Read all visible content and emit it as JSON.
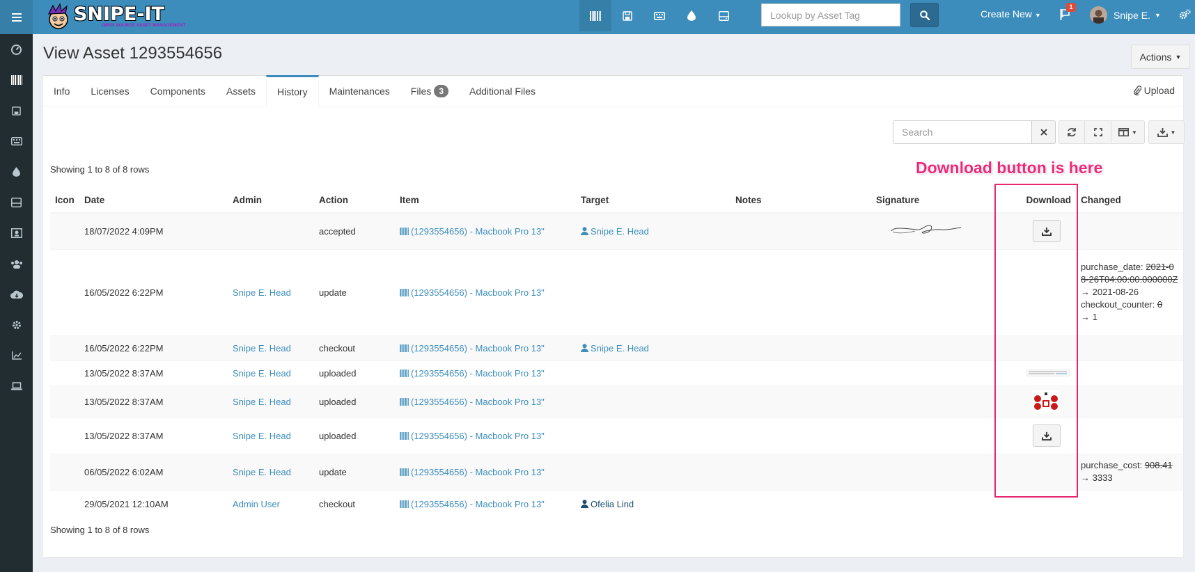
{
  "header": {
    "brand": "SNIPE-IT",
    "brand_tagline": "OPEN SOURCE ASSET MANAGEMENT",
    "lookup_placeholder": "Lookup by Asset Tag",
    "create_new": "Create New",
    "notifications_count": "1",
    "user_name": "Snipe E.",
    "nav_icons": [
      "barcode-icon",
      "save-icon",
      "keyboard-icon",
      "drop-icon",
      "hdd-icon"
    ]
  },
  "sidebar": {
    "items": [
      "dashboard-icon",
      "barcode-icon",
      "save-icon",
      "keyboard-icon",
      "drop-icon",
      "hdd-icon",
      "license-icon",
      "users-icon",
      "cloud-download-icon",
      "settings-icon",
      "chart-icon",
      "laptop-icon"
    ]
  },
  "page": {
    "title": "View Asset 1293554656",
    "actions_label": "Actions"
  },
  "tabs": [
    {
      "label": "Info"
    },
    {
      "label": "Licenses"
    },
    {
      "label": "Components"
    },
    {
      "label": "Assets"
    },
    {
      "label": "History",
      "active": true
    },
    {
      "label": "Maintenances"
    },
    {
      "label": "Files",
      "badge": "3"
    },
    {
      "label": "Additional Files"
    }
  ],
  "upload_label": "Upload",
  "table_search": {
    "placeholder": "Search"
  },
  "showing_text": "Showing 1 to 8 of 8 rows",
  "columns": [
    "Icon",
    "Date",
    "Admin",
    "Action",
    "Item",
    "Target",
    "Notes",
    "Signature",
    "Download",
    "Changed"
  ],
  "rows": [
    {
      "date": "18/07/2022 4:09PM",
      "admin": "",
      "action": "accepted",
      "item": "(1293554656) - Macbook Pro 13\"",
      "target": "Snipe E. Head",
      "signature": true,
      "download": "button",
      "changed": []
    },
    {
      "date": "16/05/2022 6:22PM",
      "admin": "Snipe E. Head",
      "action": "update",
      "item": "(1293554656) - Macbook Pro 13\"",
      "target": "",
      "download": "",
      "changed": [
        {
          "field": "purchase_date:",
          "old": "2021-08-26T04:00:00.000000Z",
          "new": "2021-08-26"
        },
        {
          "field": "checkout_counter:",
          "old": "0",
          "new": "1"
        }
      ]
    },
    {
      "date": "16/05/2022 6:22PM",
      "admin": "Snipe E. Head",
      "action": "checkout",
      "item": "(1293554656) - Macbook Pro 13\"",
      "target": "Snipe E. Head",
      "download": "",
      "changed": []
    },
    {
      "date": "13/05/2022 8:37AM",
      "admin": "Snipe E. Head",
      "action": "uploaded",
      "item": "(1293554656) - Macbook Pro 13\"",
      "target": "",
      "download": "thumb-doc",
      "changed": []
    },
    {
      "date": "13/05/2022 8:37AM",
      "admin": "Snipe E. Head",
      "action": "uploaded",
      "item": "(1293554656) - Macbook Pro 13\"",
      "target": "",
      "download": "thumb-image",
      "changed": []
    },
    {
      "date": "13/05/2022 8:37AM",
      "admin": "Snipe E. Head",
      "action": "uploaded",
      "item": "(1293554656) - Macbook Pro 13\"",
      "target": "",
      "download": "button",
      "changed": []
    },
    {
      "date": "06/05/2022 6:02AM",
      "admin": "Snipe E. Head",
      "action": "update",
      "item": "(1293554656) - Macbook Pro 13\"",
      "target": "",
      "download": "",
      "changed": [
        {
          "field": "purchase_cost:",
          "old": "908.41",
          "new": "3333"
        }
      ]
    },
    {
      "date": "29/05/2021 12:10AM",
      "admin": "Admin User",
      "action": "checkout",
      "item": "(1293554656) - Macbook Pro 13\"",
      "target": "Ofelia Lind",
      "download": "",
      "changed": []
    }
  ],
  "annotation": {
    "text": "Download button is here",
    "color": "#e8266f"
  },
  "colors": {
    "header": "#3c8dbc",
    "sidebar": "#222d32",
    "link": "#3c8dbc"
  }
}
